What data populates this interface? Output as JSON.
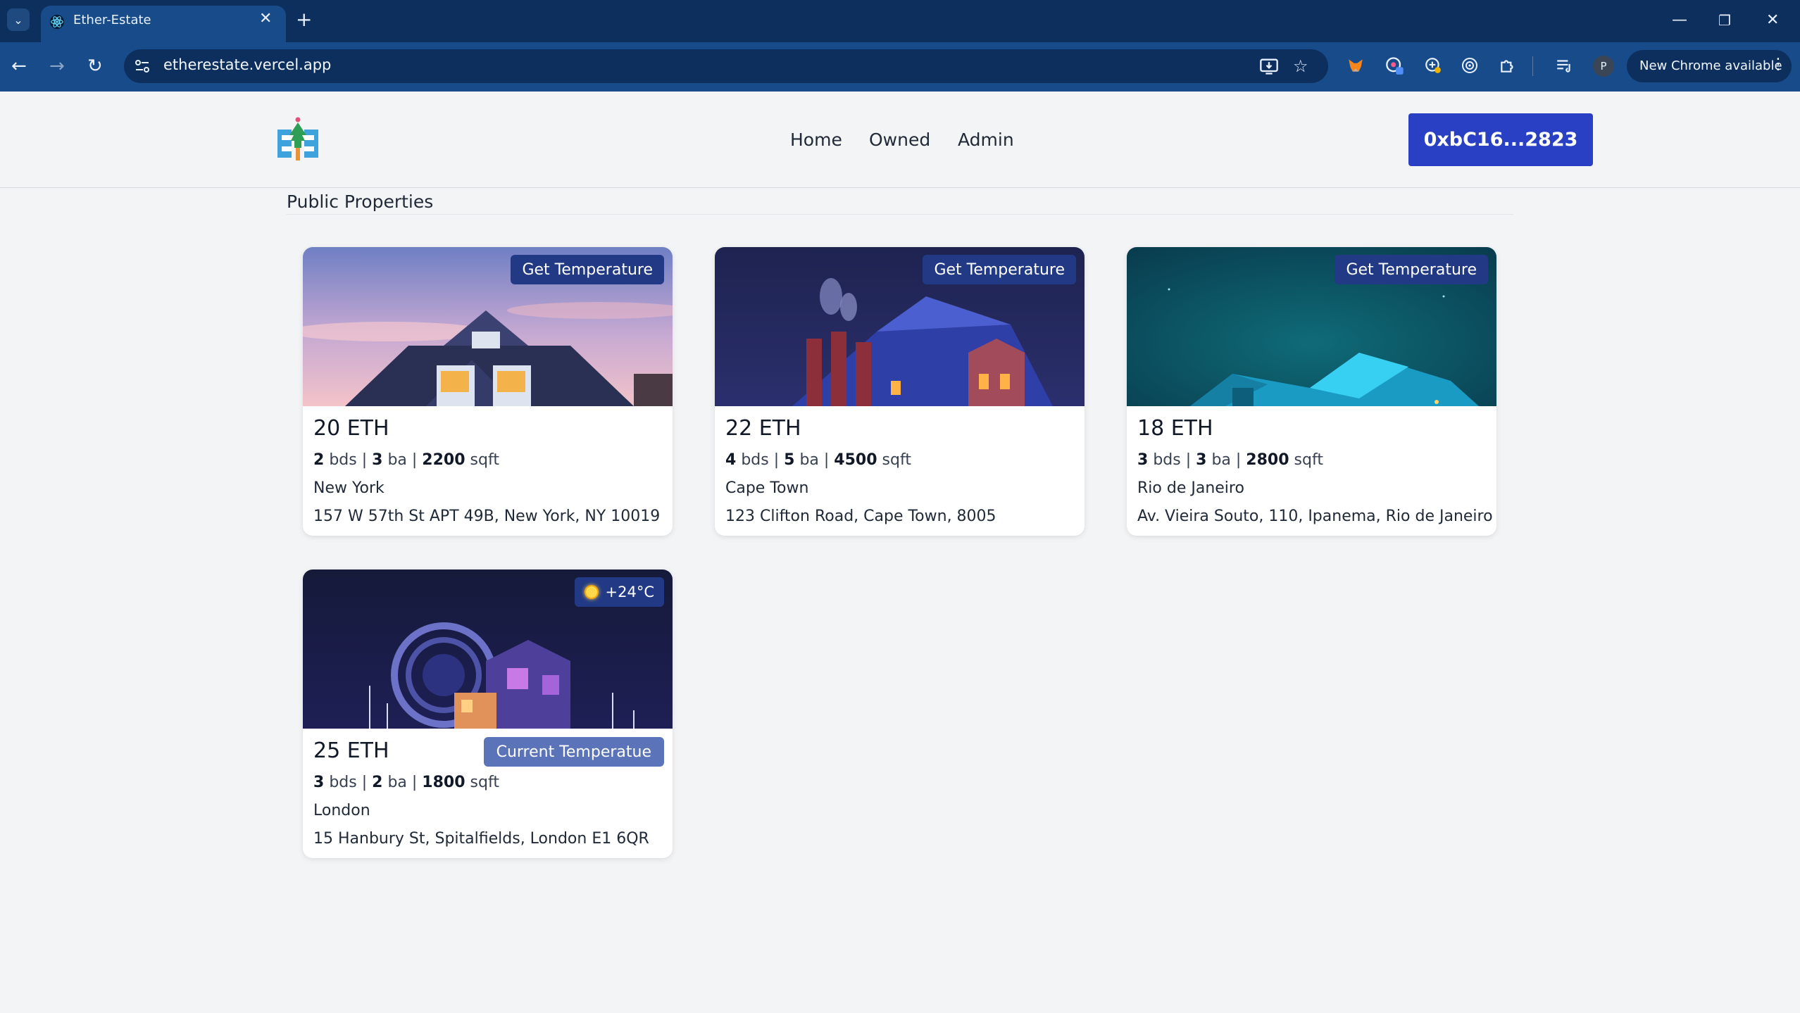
{
  "browser": {
    "tab_title": "Ether-Estate",
    "url": "etherestate.vercel.app",
    "update_label": "New Chrome available",
    "profile_initial": "P"
  },
  "app": {
    "nav": [
      "Home",
      "Owned",
      "Admin"
    ],
    "wallet_address": "0xbC16...2823",
    "section_title": "Public Properties"
  },
  "properties": [
    {
      "price": "20 ETH",
      "beds": "2",
      "beds_label": "bds",
      "baths": "3",
      "baths_label": "ba",
      "sqft": "2200",
      "sqft_label": "sqft",
      "city": "New York",
      "address": "157 W 57th St APT 49B, New York, NY 10019",
      "action": "Get Temperature"
    },
    {
      "price": "22 ETH",
      "beds": "4",
      "beds_label": "bds",
      "baths": "5",
      "baths_label": "ba",
      "sqft": "4500",
      "sqft_label": "sqft",
      "city": "Cape Town",
      "address": "123 Clifton Road, Cape Town, 8005",
      "action": "Get Temperature"
    },
    {
      "price": "18 ETH",
      "beds": "3",
      "beds_label": "bds",
      "baths": "3",
      "baths_label": "ba",
      "sqft": "2800",
      "sqft_label": "sqft",
      "city": "Rio de Janeiro",
      "address": "Av. Vieira Souto, 110, Ipanema, Rio de Janeiro",
      "action": "Get Temperature"
    },
    {
      "price": "25 ETH",
      "beds": "3",
      "beds_label": "bds",
      "baths": "2",
      "baths_label": "ba",
      "sqft": "1800",
      "sqft_label": "sqft",
      "city": "London",
      "address": "15 Hanbury St, Spitalfields, London E1 6QR",
      "temperature": "+24°C",
      "action": "Current Temperatue"
    }
  ],
  "icons": {
    "tab_search": "chevron-down-icon",
    "back": "arrow-left-icon",
    "forward": "arrow-right-icon",
    "reload": "reload-icon",
    "install": "install-app-icon",
    "bookmark": "star-icon",
    "weather": "sun-icon"
  },
  "colors": {
    "accent": "#2a40c4",
    "badge": "#223a86",
    "current_temp_button": "#5b73b8"
  }
}
